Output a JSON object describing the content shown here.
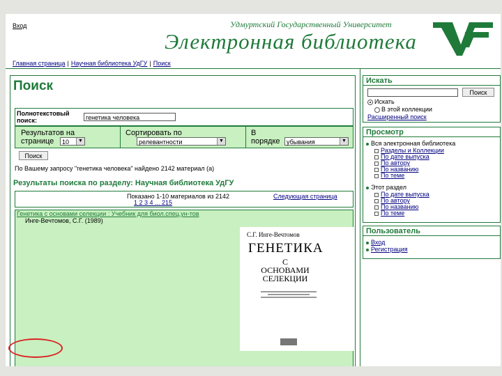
{
  "header": {
    "login": "Вход",
    "university": "Удмуртский Государственный Университет",
    "title": "Электронная библиотека",
    "logo_letters": "УГ"
  },
  "breadcrumb": [
    "Главная страница",
    "Научная библиотека УдГУ",
    "Поиск"
  ],
  "search": {
    "heading": "Поиск",
    "fulltext_label": "Полнотекстовый поиск:",
    "query": "генетика человека",
    "results_label": "Результатов на странице",
    "results_value": "10",
    "sort_label": "Сортировать по",
    "sort_value": "релевантности",
    "order_label": "В порядке",
    "order_value": "убывания",
    "button": "Поиск",
    "found_text": "По Вашему запросу \"генетика человека\" найдено 2142 материал (а)"
  },
  "results": {
    "heading": "Результаты поиска по разделу: Научная библиотека УдГУ",
    "shown": "Показано 1-10 материалов из 2142",
    "pages": "1 2 3 4 ... 215",
    "next": "Следующая страница",
    "item_title": "Генетика с основами селекции : Учебник для биол.спец.ун-тов",
    "item_author": "Инге-Вечтомов, С.Г. (1989)",
    "book_author": "С.Г. Инге-Вечтомов",
    "book_title": "ГЕНЕТИКА",
    "book_sub": [
      "С",
      "ОСНОВАМИ",
      "СЕЛЕКЦИИ"
    ]
  },
  "sidebar": {
    "find": {
      "heading": "Искать",
      "button": "Поиск",
      "radio_all": "Искать",
      "radio_section": "В этой коллекции",
      "advanced": "Расширенный поиск"
    },
    "browse": {
      "heading": "Просмотр",
      "all_label": "Вся электронная библиотека",
      "all_items": [
        "Разделы и Коллекции",
        "По дате выпуска",
        "По автору",
        "По названию",
        "По теме"
      ],
      "section_label": "Этот раздел",
      "section_items": [
        "По дате выпуска",
        "По автору",
        "По названию",
        "По теме"
      ]
    },
    "user": {
      "heading": "Пользователь",
      "items": [
        "Вход",
        "Регистрация"
      ]
    }
  }
}
